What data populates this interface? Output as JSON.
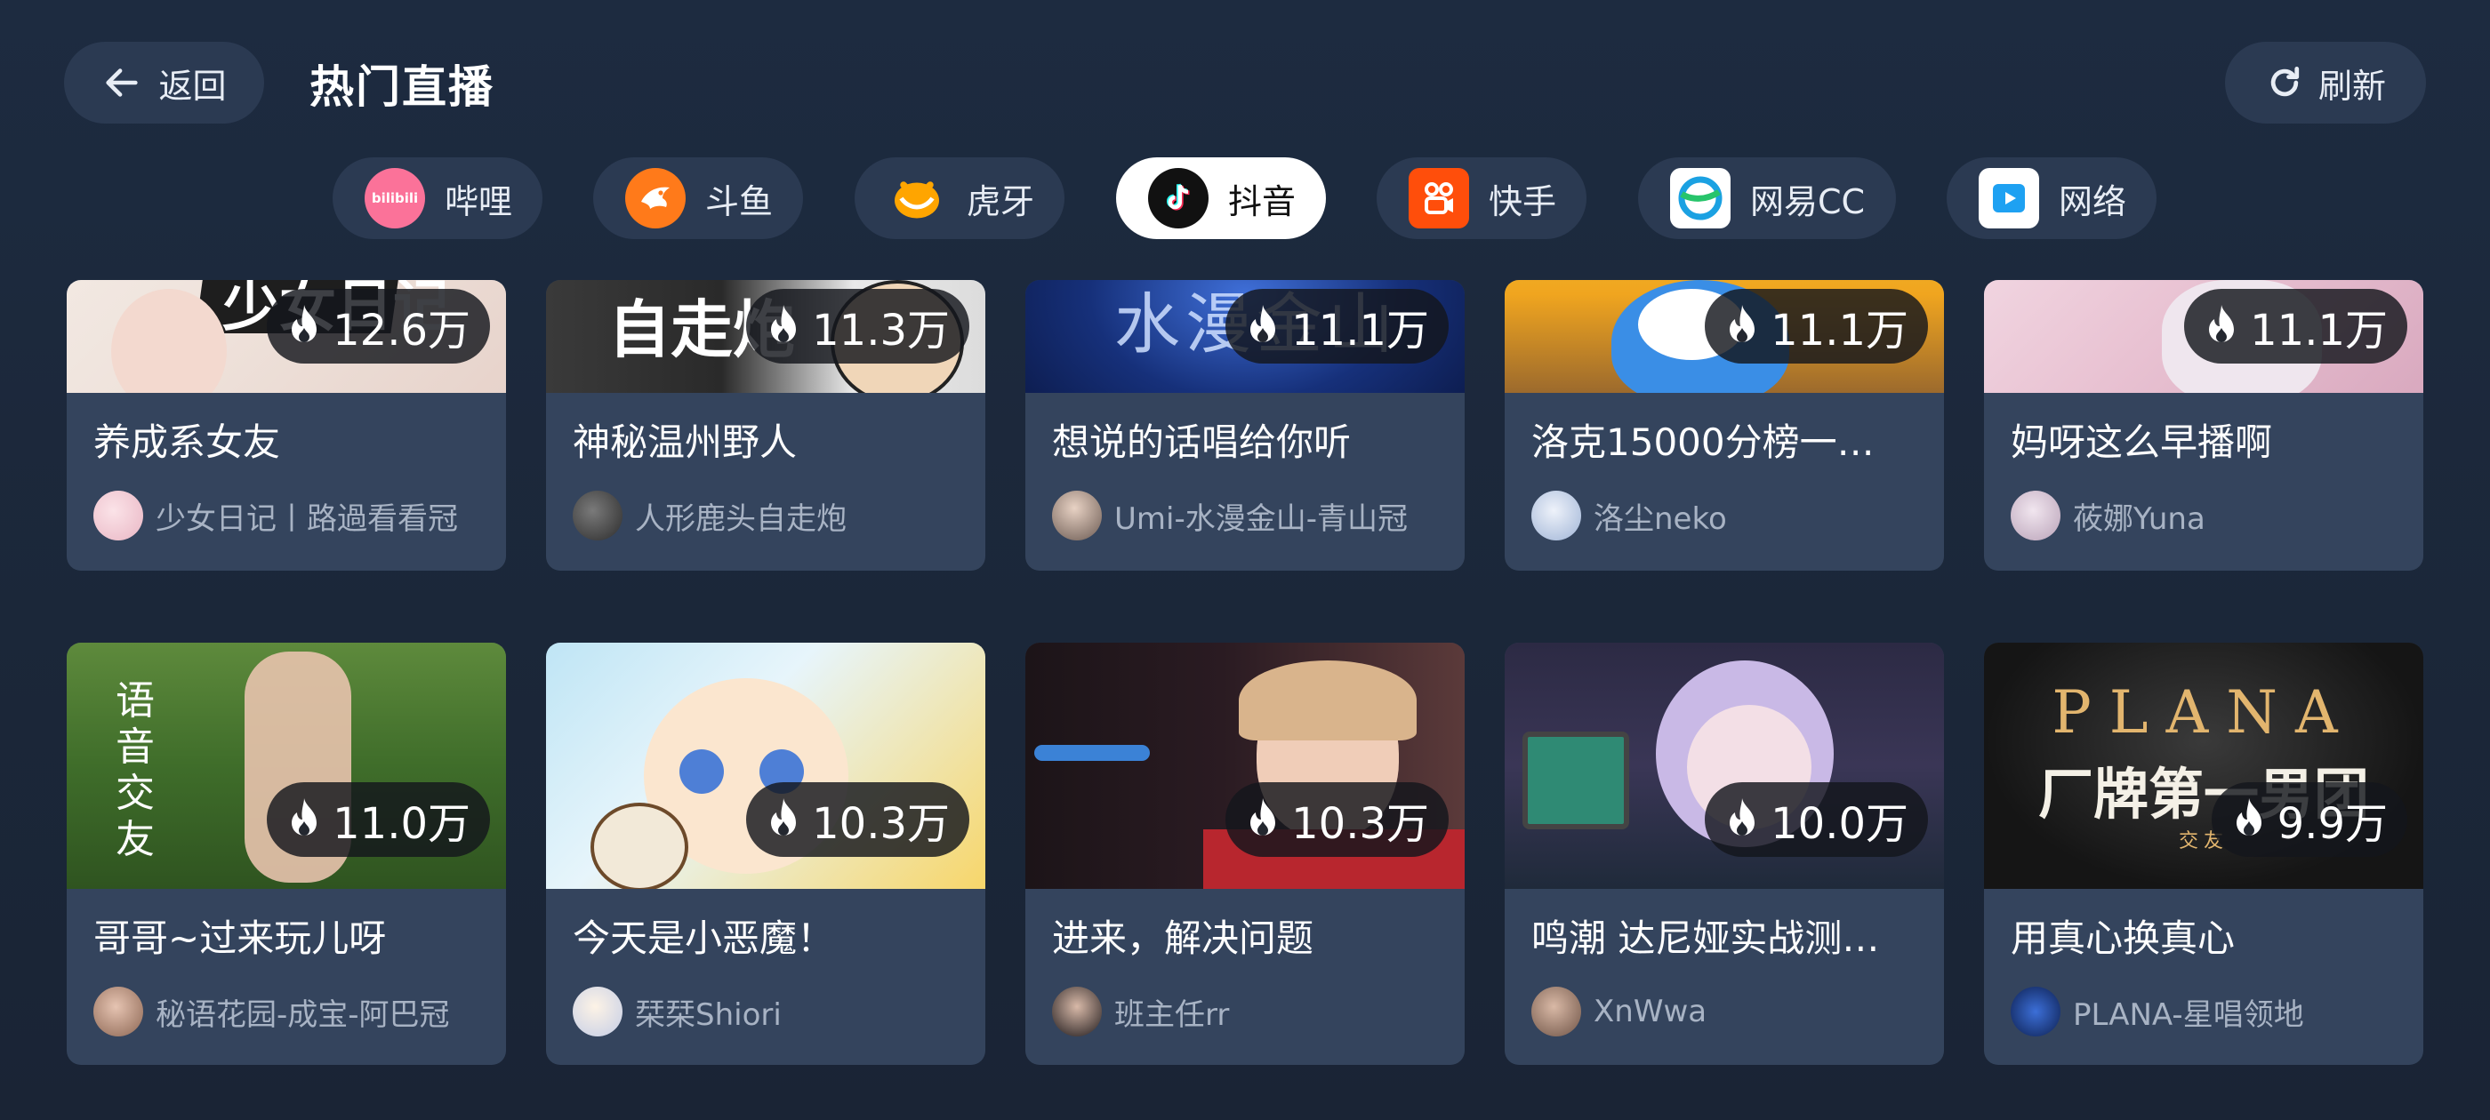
{
  "header": {
    "back_label": "返回",
    "title": "热门直播",
    "refresh_label": "刷新"
  },
  "tabs": [
    {
      "label": "哔哩",
      "icon": "bilibili-icon",
      "icon_text": "bilibili",
      "color": "#fb7299",
      "active": false
    },
    {
      "label": "斗鱼",
      "icon": "douyu-icon",
      "color": "#ff7a1a",
      "active": false
    },
    {
      "label": "虎牙",
      "icon": "huya-icon",
      "color": "#ffa500",
      "active": false
    },
    {
      "label": "抖音",
      "icon": "douyin-icon",
      "color": "#111111",
      "active": true
    },
    {
      "label": "快手",
      "icon": "kuaishou-icon",
      "color": "#ff4e0b",
      "active": false
    },
    {
      "label": "网易CC",
      "icon": "netease-cc-icon",
      "color": "#1ba1e2",
      "active": false
    },
    {
      "label": "网络",
      "icon": "network-play-icon",
      "color": "#1ea1f2",
      "active": false
    }
  ],
  "rows": [
    {
      "cards": [
        {
          "title": "养成系女友",
          "streamer": "少女日记丨路過看看冠",
          "hot": "12.6万"
        },
        {
          "title": "神秘温州野人",
          "streamer": "人形鹿头自走炮",
          "hot": "11.3万"
        },
        {
          "title": "想说的话唱给你听",
          "streamer": "Umi-水漫金山-青山冠",
          "hot": "11.1万"
        },
        {
          "title": "洛克15000分榜一…",
          "streamer": "洛尘neko",
          "hot": "11.1万"
        },
        {
          "title": "妈呀这么早播啊",
          "streamer": "莜娜Yuna",
          "hot": "11.1万"
        }
      ]
    },
    {
      "cards": [
        {
          "title": "哥哥~过来玩儿呀",
          "streamer": "秘语花园-成宝-阿巴冠",
          "hot": "11.0万"
        },
        {
          "title": "今天是小恶魔！",
          "streamer": "栞栞Shiori",
          "hot": "10.3万"
        },
        {
          "title": "进来，解决问题",
          "streamer": "班主任rr",
          "hot": "10.3万"
        },
        {
          "title": "鸣潮 达尼娅实战测…",
          "streamer": "XnWwa",
          "hot": "10.0万"
        },
        {
          "title": "用真心换真心",
          "streamer": "PLANA-星唱领地",
          "hot": "9.9万"
        }
      ]
    }
  ],
  "thumb_text": {
    "r0c0": "少女日记",
    "r0c1": "自走炮",
    "r0c2": "水漫金山",
    "r1c0": "语音交友",
    "r1c4_line1": "PLANA",
    "r1c4_line2": "厂牌第一男团",
    "r1c4_line3": "交友"
  }
}
